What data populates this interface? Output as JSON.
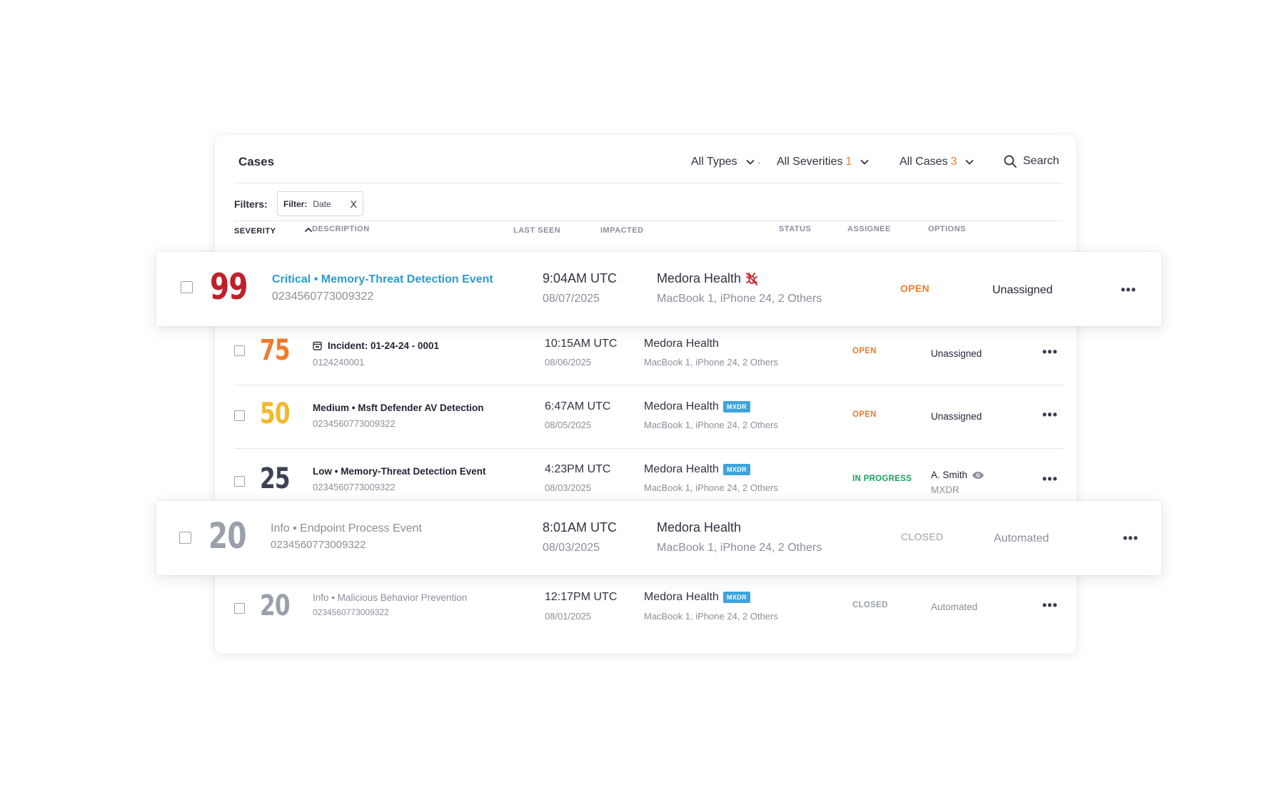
{
  "header": {
    "title": "Cases",
    "types_label": "All Types",
    "severities_label": "All Severities",
    "severities_count": "1",
    "cases_label": "All Cases",
    "cases_count": "3",
    "search_label": "Search"
  },
  "filters": {
    "label": "Filters:",
    "chip_key": "Filter:",
    "chip_value": "Date",
    "chip_remove": "X"
  },
  "columns": {
    "severity": "SEVERITY",
    "description": "DESCRIPTION",
    "last_seen": "LAST SEEN",
    "impacted": "IMPACTED",
    "status": "STATUS",
    "assignee": "ASSIGNEE",
    "options": "OPTIONS"
  },
  "colors": {
    "critical": "#c0202a",
    "high": "#ef7c2d",
    "medium": "#f2b82e",
    "low": "#3c4352",
    "info": "#9aa0ab",
    "link": "#2c9bd0",
    "open": "#ef7c2d",
    "in_progress": "#17a05d",
    "closed": "#9aa0ab",
    "mxdr_badge": "#3ea3dc"
  },
  "rows": [
    {
      "score": "99",
      "title": "Critical • Memory-Threat Detection Event",
      "id": "0234560773009322",
      "time": "9:04AM UTC",
      "date": "08/07/2025",
      "org": "Medora Health",
      "org_icon": "bug-alert-icon",
      "devices": "MacBook 1, iPhone 24, 2 Others",
      "status": "OPEN",
      "assignee": "Unassigned",
      "options": "•••"
    },
    {
      "score": "75",
      "title": "Incident: 01-24-24 - 0001",
      "title_icon": "calendar-icon",
      "id": "0124240001",
      "time": "10:15AM UTC",
      "date": "08/06/2025",
      "org": "Medora Health",
      "devices": "MacBook 1, iPhone 24, 2 Others",
      "status": "OPEN",
      "assignee": "Unassigned",
      "options": "•••"
    },
    {
      "score": "50",
      "title": "Medium • Msft Defender AV Detection",
      "id": "0234560773009322",
      "time": "6:47AM UTC",
      "date": "08/05/2025",
      "org": "Medora Health",
      "badge": "MXDR",
      "devices": "MacBook 1, iPhone 24, 2 Others",
      "status": "OPEN",
      "assignee": "Unassigned",
      "options": "•••"
    },
    {
      "score": "25",
      "title": "Low • Memory-Threat Detection Event",
      "id": "0234560773009322",
      "time": "4:23PM UTC",
      "date": "08/03/2025",
      "org": "Medora Health",
      "badge": "MXDR",
      "devices": "MacBook 1, iPhone 24, 2 Others",
      "status": "IN PROGRESS",
      "assignee": "A. Smith",
      "assignee_icon": "eye-icon",
      "assignee_sub": "MXDR",
      "options": "•••"
    },
    {
      "score": "20",
      "title": "Info • Endpoint Process Event",
      "id": "0234560773009322",
      "time": "8:01AM UTC",
      "date": "08/03/2025",
      "org": "Medora Health",
      "devices": "MacBook 1, iPhone 24, 2 Others",
      "status": "CLOSED",
      "assignee": "Automated",
      "options": "•••"
    },
    {
      "score": "20",
      "title": "Info • Malicious Behavior Prevention",
      "id": "0234560773009322",
      "time": "12:17PM UTC",
      "date": "08/01/2025",
      "org": "Medora Health",
      "badge": "MXDR",
      "devices": "MacBook 1, iPhone 24, 2 Others",
      "status": "CLOSED",
      "assignee": "Automated",
      "options": "•••"
    }
  ]
}
